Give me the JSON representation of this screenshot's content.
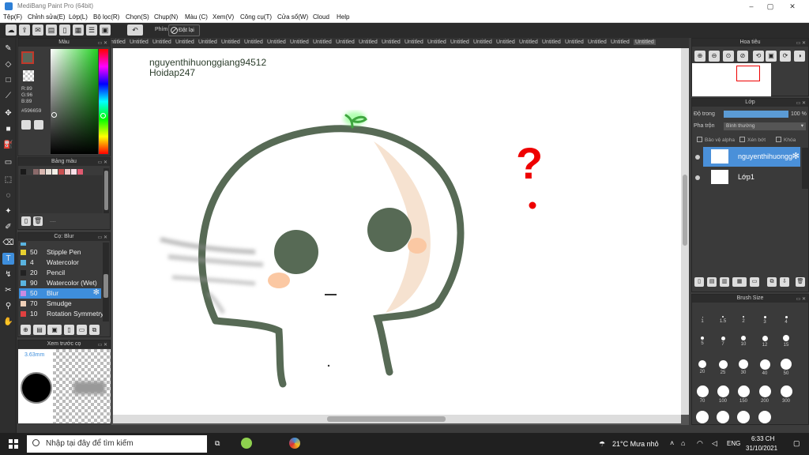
{
  "window": {
    "title": "MediBang Paint Pro (64bit)"
  },
  "menu": [
    "Tệp(F)",
    "Chỉnh sửa(E)",
    "Lớp(L)",
    "Bộ lọc(R)",
    "Chọn(S)",
    "Chụp(N)",
    "Màu (C)",
    "Xem(V)",
    "Công cụ(T)",
    "Cửa sổ(W)",
    "Cloud",
    "Help"
  ],
  "toolbar": {
    "key_label": "Phím",
    "reset_label": "Đặt lại"
  },
  "color_panel": {
    "title": "Màu",
    "r": "R:89",
    "g": "G:96",
    "b": "B:89",
    "hex": "#596659",
    "current_color": "#596659"
  },
  "palette_panel": {
    "title": "Bảng màu",
    "swatches": [
      "#1a1a1a",
      "#3c3c3c",
      "#8a6a6a",
      "#d9b7b0",
      "#e8e0d8",
      "#f4f0e8",
      "#c94f4f",
      "#f2c9c9",
      "#f9e0e8",
      "#e05a70"
    ],
    "more": "...."
  },
  "brush_panel": {
    "title": "Cọ: Blur",
    "items": [
      {
        "size": "50",
        "name": "Stipple Pen",
        "color": "#e8d030"
      },
      {
        "size": "4",
        "name": "Watercolor",
        "color": "#5ab4e0"
      },
      {
        "size": "20",
        "name": "Pencil",
        "color": "#222222"
      },
      {
        "size": "90",
        "name": "Watercolor (Wet)",
        "color": "#5ab4e0"
      },
      {
        "size": "50",
        "name": "Blur",
        "color": "#c98be0"
      },
      {
        "size": "70",
        "name": "Smudge",
        "color": "#f0d0b8"
      },
      {
        "size": "10",
        "name": "Rotation Symmetry",
        "color": "#e04040"
      }
    ]
  },
  "preview_panel": {
    "title": "Xem trước cọ",
    "size": "3.63mm"
  },
  "tabs": [
    "Untitled",
    "Untitled",
    "Untitled",
    "Untitled",
    "Untitled",
    "Untitled",
    "Untitled",
    "Untitled",
    "Untitled",
    "Untitled",
    "Untitled",
    "Untitled",
    "Untitled",
    "Untitled",
    "Untitled",
    "Untitled",
    "Untitled",
    "Untitled",
    "Untitled",
    "Untitled",
    "Untitled",
    "Untitled",
    "Untitled",
    "Untitled"
  ],
  "canvas": {
    "line1": "nguyenthihuonggiang94512",
    "line2": "Hoidap247",
    "question_mark": "?"
  },
  "navigator": {
    "title": "Hoa tiêu"
  },
  "layer_panel": {
    "title": "Lớp",
    "opacity_label": "Độ trong",
    "opacity_value": "100 %",
    "opacity": 100,
    "blend_label": "Pha trộn",
    "blend_value": "Bình thường",
    "protect_alpha": "Bảo vệ alpha",
    "clipping": "Xén bớt",
    "lock": "Khóa",
    "layers": [
      {
        "name": "nguyenthihuonggiang94512"
      },
      {
        "name": "Lớp1"
      }
    ]
  },
  "brush_size_panel": {
    "title": "Brush Size",
    "sizes": [
      "1",
      "1.5",
      "2",
      "3",
      "4",
      "5",
      "7",
      "10",
      "12",
      "15",
      "20",
      "25",
      "30",
      "40",
      "50",
      "70",
      "100",
      "150",
      "200",
      "300"
    ]
  },
  "taskbar": {
    "search_placeholder": "Nhập tại đây để tìm kiếm",
    "weather": "21°C  Mưa nhỏ",
    "lang": "ENG",
    "time": "6:33 CH",
    "date": "31/10/2021"
  }
}
